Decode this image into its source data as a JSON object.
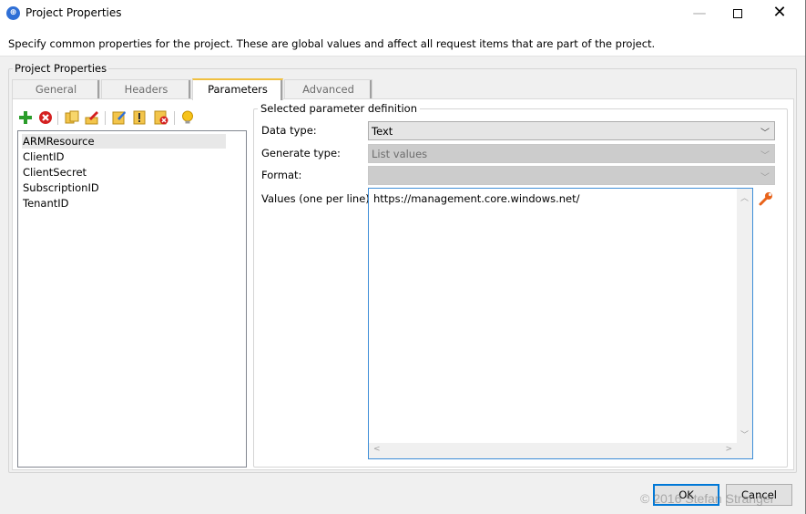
{
  "window": {
    "title": "Project Properties",
    "minimize_glyph": "—",
    "close_glyph": "✕"
  },
  "description": "Specify common properties for the project. These are global values and affect all request items that are part of the project.",
  "group_title": "Project Properties",
  "tabs": [
    {
      "label": "General",
      "active": false
    },
    {
      "label": "Headers",
      "active": false
    },
    {
      "label": "Parameters",
      "active": true
    },
    {
      "label": "Advanced",
      "active": false
    }
  ],
  "toolbar": {
    "icons": [
      "add-icon",
      "delete-icon",
      "copy-icon",
      "rename-icon",
      "edit-values-icon",
      "info-icon",
      "clear-icon",
      "hint-icon"
    ]
  },
  "parameters": {
    "items": [
      "ARMResource",
      "ClientID",
      "ClientSecret",
      "SubscriptionID",
      "TenantID"
    ],
    "selected_index": 0
  },
  "definition": {
    "legend": "Selected parameter definition",
    "data_type_label": "Data type:",
    "data_type_value": "Text",
    "generate_type_label": "Generate type:",
    "generate_type_value": "List values",
    "format_label": "Format:",
    "format_value": "",
    "values_label": "Values (one per line):",
    "values_text": "https://management.core.windows.net/"
  },
  "buttons": {
    "ok_label": "OK",
    "cancel_label": "Cancel"
  },
  "watermark": "© 2016 Stefan Stranger",
  "colors": {
    "focus_border": "#0078d7",
    "active_tab_accent": "#f0c040",
    "add_green": "#2a9d2a",
    "delete_red": "#d42020"
  }
}
